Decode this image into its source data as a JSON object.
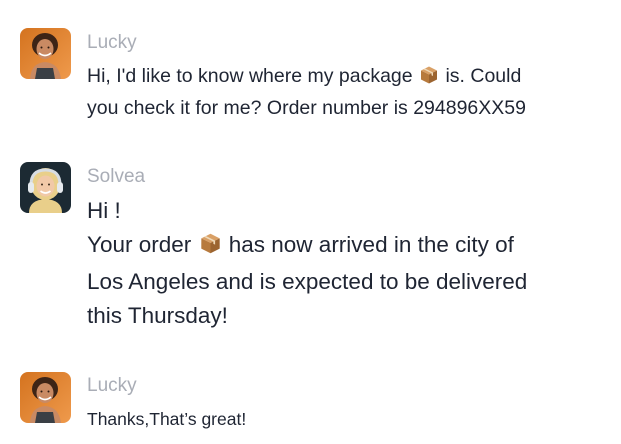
{
  "conversation": {
    "messages": [
      {
        "sender": "Lucky",
        "avatar_icon": "customer-avatar",
        "text_before": "Hi, I'd like to know where my package ",
        "emoji": "package-emoji",
        "text_after": " is. Could\nyou check it for me? Order number is 294896XX59"
      },
      {
        "sender": "Solvea",
        "avatar_icon": "agent-avatar-headset",
        "line1": "Hi !",
        "text_before": "Your order ",
        "emoji": "package-emoji",
        "text_after": " has now arrived in the city of\nLos Angeles and is expected to be delivered\nthis Thursday!"
      },
      {
        "sender": "Lucky",
        "avatar_icon": "customer-avatar",
        "text": "Thanks,That’s great!"
      }
    ]
  },
  "colors": {
    "sender_name": "#a9adb6",
    "message_text": "#1f2533",
    "customer_avatar_bg": "#e0853a",
    "agent_avatar_bg": "#1c2a33"
  }
}
